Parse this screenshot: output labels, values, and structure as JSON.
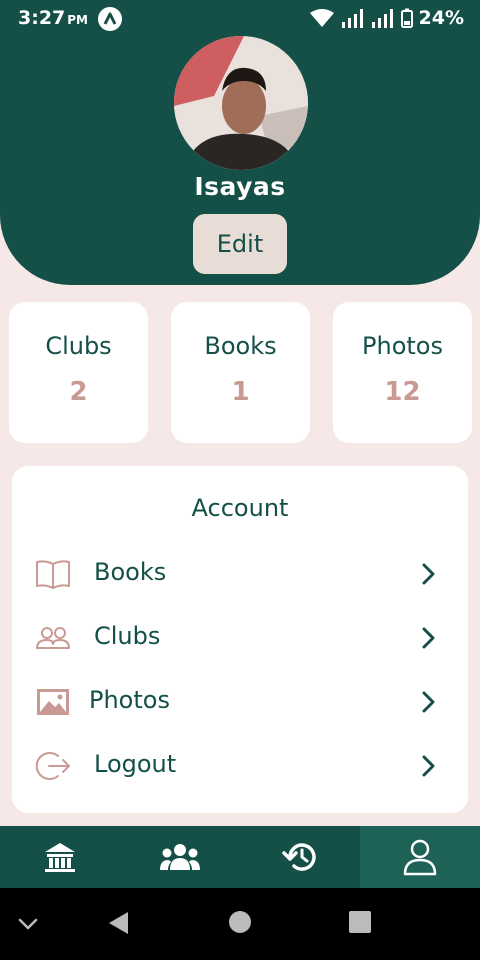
{
  "status_bar": {
    "time": "3:27",
    "ampm": "PM",
    "battery_percent": "24%"
  },
  "profile": {
    "name": "Isayas",
    "edit_label": "Edit"
  },
  "stats": [
    {
      "label": "Clubs",
      "value": "2"
    },
    {
      "label": "Books",
      "value": "1"
    },
    {
      "label": "Photos",
      "value": "12"
    }
  ],
  "account": {
    "title": "Account",
    "items": [
      {
        "label": "Books",
        "icon": "book-icon"
      },
      {
        "label": "Clubs",
        "icon": "group-icon"
      },
      {
        "label": "Photos",
        "icon": "image-icon"
      },
      {
        "label": "Logout",
        "icon": "logout-icon"
      }
    ]
  },
  "bottom_nav": {
    "items": [
      {
        "icon": "home-icon",
        "active": false
      },
      {
        "icon": "group-icon",
        "active": false
      },
      {
        "icon": "history-icon",
        "active": false
      },
      {
        "icon": "user-icon",
        "active": true
      }
    ]
  },
  "colors": {
    "primary": "#145048",
    "background": "#f5e8e6",
    "accent": "#c99a94",
    "button_bg": "#e7ddd6"
  }
}
